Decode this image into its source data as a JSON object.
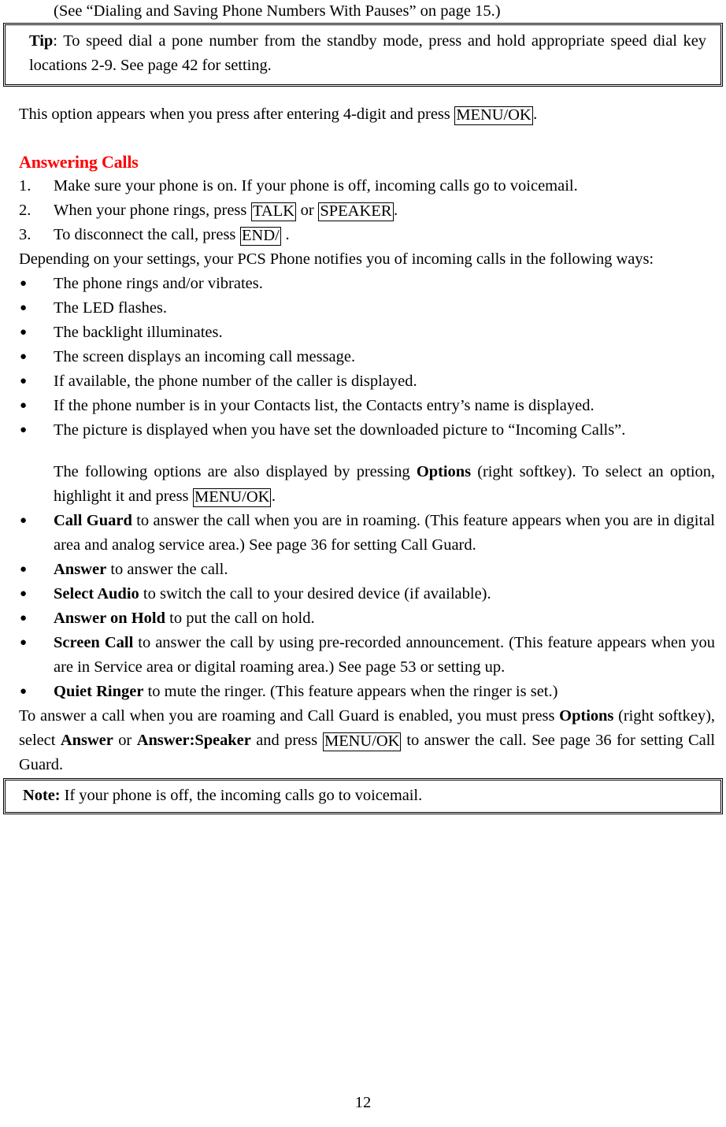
{
  "document": {
    "page_number": "12",
    "accent_color": "#FF0000",
    "text_color": "#000000"
  },
  "top_caption": "(See “Dialing and Saving Phone Numbers With Pauses” on page 15.)",
  "tip_box": {
    "label": "Tip",
    "label_suffix": ":",
    "text": "To speed dial a pone number from the standby mode, press and hold appropriate speed dial key locations 2-9. See page 42 for setting."
  },
  "intro_paragraph": {
    "part1": "This option appears when you press after entering 4-digit and press ",
    "keycap": "MENU/OK",
    "part2": "."
  },
  "section": {
    "heading": "Answering Calls"
  },
  "steps": [
    {
      "marker": "1.",
      "text": "Make sure your phone is on. If your phone is off, incoming calls go to voicemail."
    },
    {
      "marker": "2.",
      "prefix": "When your phone rings, press ",
      "keycap1": "TALK",
      "middle": " or ",
      "keycap2": "SPEAKER",
      "suffix": "."
    },
    {
      "marker": "3.",
      "prefix": "To disconnect the call, press ",
      "keycap1": "END/",
      "suffix": " ."
    }
  ],
  "notify_paragraph": "Depending on your settings, your PCS Phone notifies you of incoming calls in the following ways:",
  "notify_bullets": [
    "The phone rings and/or vibrates.",
    "The LED flashes.",
    "The backlight illuminates.",
    "The screen displays an incoming call message.",
    "If available, the phone number of the caller is displayed.",
    "If the phone number is in your Contacts list, the Contacts entry’s name is displayed.",
    "The picture is displayed when you have set the downloaded picture to “Incoming Calls”."
  ],
  "options_intro": {
    "part1": "The following options are also displayed by pressing ",
    "bold1": "Options",
    "part2": " (right softkey). To select an option, highlight it and press ",
    "keycap": "MENU/OK",
    "part3": "."
  },
  "option_bullets": [
    {
      "term": "Call Guard",
      "text": " to answer the call when you are in roaming. (This feature appears when you are in digital area and analog service area.) See page 36 for setting Call Guard."
    },
    {
      "term": "Answer",
      "text": " to answer the call."
    },
    {
      "term": "Select Audio",
      "text": " to switch the call to your desired device (if available)."
    },
    {
      "term": "Answer on Hold",
      "text": " to put the call on hold."
    },
    {
      "term": "Screen Call",
      "text": " to answer the call by using pre-recorded announcement. (This feature appears when you are in Service area or digital roaming area.) See page 53 or setting up."
    },
    {
      "term": "Quiet Ringer",
      "text": " to mute the ringer. (This feature appears when the ringer is set.)"
    }
  ],
  "closing_paragraph": {
    "part1": "To answer a call when you are roaming and Call Guard is enabled, you must press ",
    "bold1": "Options",
    "part2": " (right softkey), select ",
    "bold2": "Answer",
    "part3": " or ",
    "bold3": "Answer:Speaker",
    "part4": " and press ",
    "keycap": "MENU/OK",
    "part5": " to answer the call. See page 36 for setting Call Guard."
  },
  "note_box": {
    "label": "Note:",
    "text": " If your phone is off, the incoming calls go to voicemail."
  },
  "bullet_glyph": "●"
}
